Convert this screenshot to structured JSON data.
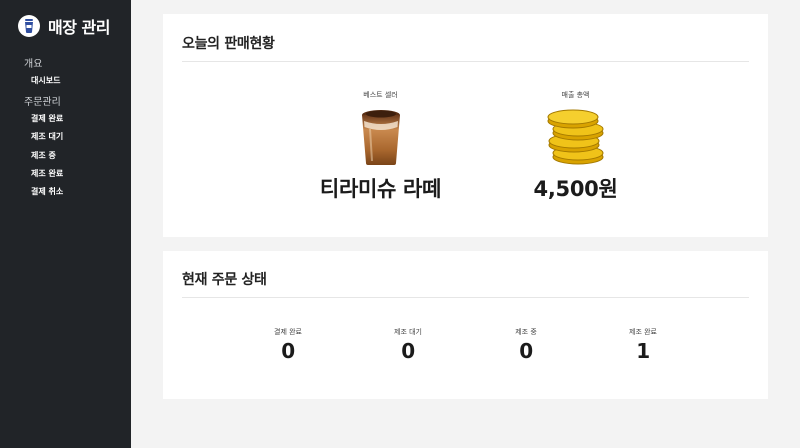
{
  "sidebar": {
    "title": "매장 관리",
    "groups": [
      {
        "label": "개요",
        "items": [
          "대시보드"
        ]
      },
      {
        "label": "주문관리",
        "items": [
          "결제 완료",
          "제조 대기",
          "제조 중",
          "제조 완료",
          "결제 취소"
        ]
      }
    ]
  },
  "sales": {
    "title": "오늘의 판매현황",
    "best_seller_label": "베스트 셀러",
    "best_seller_value": "티라미슈 라떼",
    "total_label": "매출 총액",
    "total_value": "4,500원"
  },
  "orders": {
    "title": "현재 주문 상태",
    "statuses": [
      {
        "label": "결제 완료",
        "value": "0"
      },
      {
        "label": "제조 대기",
        "value": "0"
      },
      {
        "label": "제조 중",
        "value": "0"
      },
      {
        "label": "제조 완료",
        "value": "1"
      }
    ]
  },
  "colors": {
    "sidebar_bg": "#212428",
    "page_bg": "#f3f3f3",
    "card_bg": "#ffffff",
    "brand_accent": "#2f4ea0",
    "coin": "#e8b400"
  },
  "icons": {
    "brand": "coffee-cup-icon",
    "best_seller": "latte-cup-image",
    "total": "coin-stack-image"
  }
}
